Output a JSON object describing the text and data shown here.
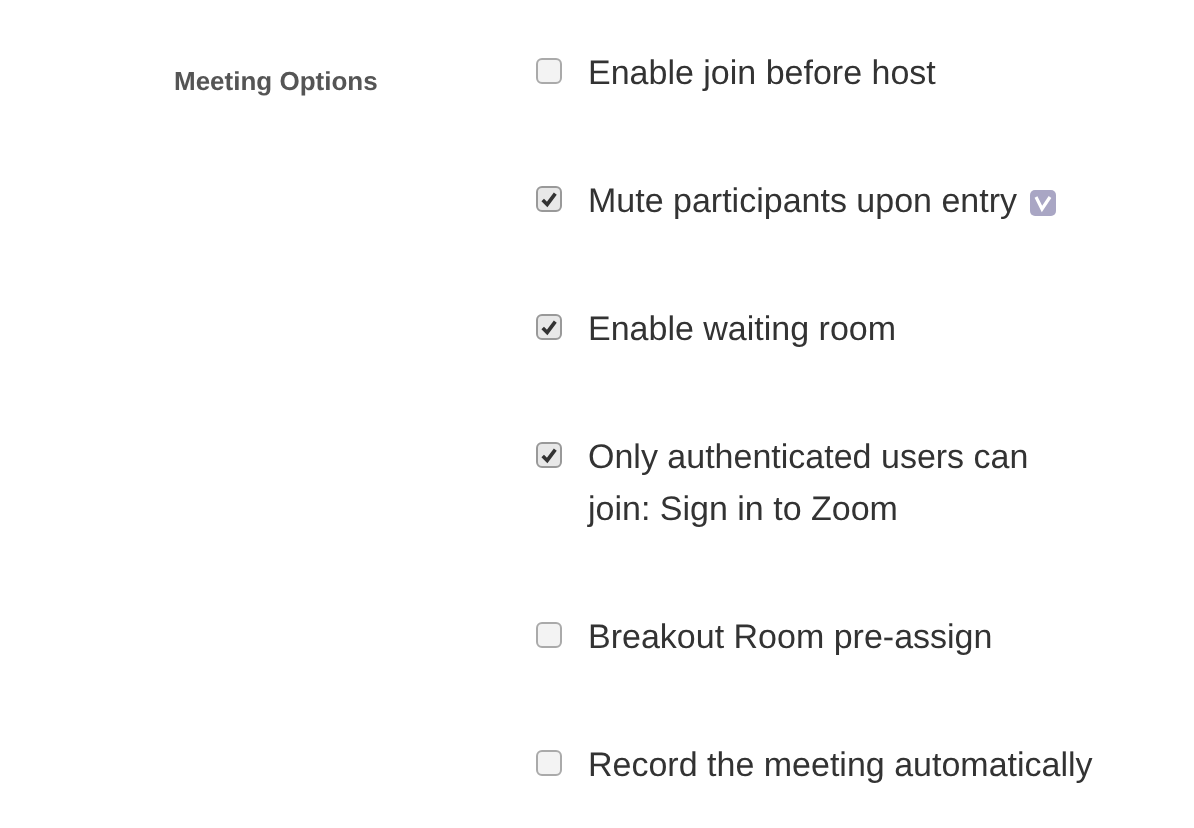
{
  "section_label": "Meeting Options",
  "options": [
    {
      "label": "Enable join before host",
      "checked": false,
      "badge": false
    },
    {
      "label": "Mute participants upon entry",
      "checked": true,
      "badge": true
    },
    {
      "label": "Enable waiting room",
      "checked": true,
      "badge": false
    },
    {
      "label": "Only authenticated users can\njoin: Sign in to Zoom",
      "checked": true,
      "badge": false
    },
    {
      "label": "Breakout Room pre-assign",
      "checked": false,
      "badge": false
    },
    {
      "label": "Record the meeting automatically",
      "checked": false,
      "badge": false
    }
  ]
}
